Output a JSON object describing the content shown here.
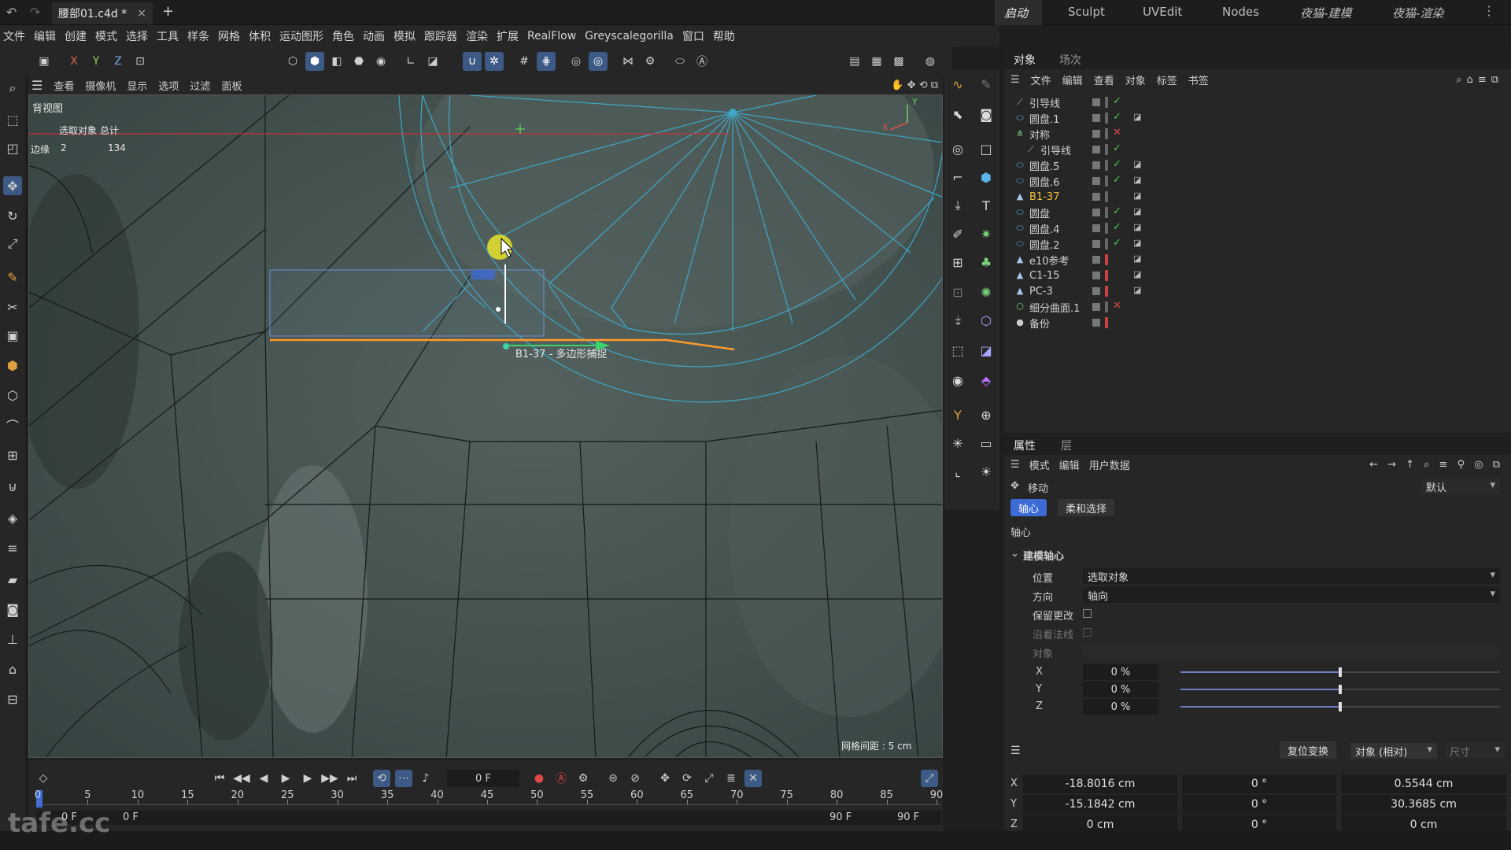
{
  "titlebar": {
    "document_tab": "腰部01.c4d *",
    "new_tab": "+",
    "close": "×",
    "layouts": [
      "启动",
      "Sculpt",
      "UVEdit",
      "Nodes",
      "夜猫-建模",
      "夜猫-渲染"
    ],
    "active_layout": "启动"
  },
  "menubar": [
    "文件",
    "编辑",
    "创建",
    "模式",
    "选择",
    "工具",
    "样条",
    "网格",
    "体积",
    "运动图形",
    "角色",
    "动画",
    "模拟",
    "跟踪器",
    "渲染",
    "扩展",
    "RealFlow",
    "Greyscalegorilla",
    "窗口",
    "帮助"
  ],
  "toolbar": {
    "axes": [
      "X",
      "Y",
      "Z"
    ]
  },
  "viewport": {
    "menu": [
      "查看",
      "摄像机",
      "显示",
      "选项",
      "过滤",
      "面板"
    ],
    "view_name": "背视图",
    "stats_header": "选取对象 总计",
    "stats_row_label": "边缘",
    "stats_selected": "2",
    "stats_total": "134",
    "snap_tooltip": "B1-37 - 多边形捕捉",
    "grid_spacing": "网格间距 : 5 cm",
    "axis_x": "X",
    "axis_y": "Y"
  },
  "object_manager": {
    "tabs": [
      "对象",
      "场次"
    ],
    "menu": [
      "文件",
      "编辑",
      "查看",
      "对象",
      "标签",
      "书签"
    ],
    "objects": [
      {
        "name": "引导线",
        "icon": "spline-icon",
        "indent": 0,
        "check": "green"
      },
      {
        "name": "圆盘.1",
        "icon": "disc-icon",
        "indent": 0,
        "check": "green"
      },
      {
        "name": "对称",
        "icon": "symmetry-icon",
        "indent": 0,
        "check": "red"
      },
      {
        "name": "引导线",
        "icon": "spline-icon",
        "indent": 1,
        "check": "green"
      },
      {
        "name": "圆盘.5",
        "icon": "disc-icon",
        "indent": 0,
        "check": "green"
      },
      {
        "name": "圆盘.6",
        "icon": "disc-icon",
        "indent": 0,
        "check": "green"
      },
      {
        "name": "B1-37",
        "icon": "polygon-icon",
        "indent": 0,
        "check": "none",
        "highlight": true
      },
      {
        "name": "圆盘",
        "icon": "disc-icon",
        "indent": 0,
        "check": "green"
      },
      {
        "name": "圆盘.4",
        "icon": "disc-icon",
        "indent": 0,
        "check": "green"
      },
      {
        "name": "圆盘.2",
        "icon": "disc-icon",
        "indent": 0,
        "check": "green"
      },
      {
        "name": "e10参考",
        "icon": "polygon-icon",
        "indent": 0,
        "check": "dot-red"
      },
      {
        "name": "C1-15",
        "icon": "polygon-icon",
        "indent": 0,
        "check": "dot-red"
      },
      {
        "name": "PC-3",
        "icon": "polygon-icon",
        "indent": 0,
        "check": "dot-red"
      },
      {
        "name": "细分曲面.1",
        "icon": "subdivision-icon",
        "indent": 0,
        "check": "red"
      },
      {
        "name": "备份",
        "icon": "null-icon",
        "indent": 0,
        "check": "dot-red"
      }
    ]
  },
  "attributes": {
    "tabs": [
      "属性",
      "层"
    ],
    "menu": [
      "模式",
      "编辑",
      "用户数据"
    ],
    "tool_name": "移动",
    "preset": "默认",
    "subtabs": [
      "轴心",
      "柔和选择"
    ],
    "section": "轴心",
    "group": "建模轴心",
    "position_label": "位置",
    "position_value": "选取对象",
    "direction_label": "方向",
    "direction_value": "轴向",
    "keep_changes": "保留更改",
    "along_normal": "沿着法线",
    "object_label": "对象",
    "axes": [
      {
        "label": "X",
        "value": "0 %",
        "fraction": 0.5
      },
      {
        "label": "Y",
        "value": "0 %",
        "fraction": 0.5
      },
      {
        "label": "Z",
        "value": "0 %",
        "fraction": 0.5
      }
    ]
  },
  "coordinates": {
    "reset_button": "复位变换",
    "mode": "对象 (相对)",
    "size_label": "尺寸",
    "rows": [
      {
        "axis": "X",
        "pos": "-18.8016 cm",
        "rot": "0 °",
        "size": "0.5544 cm"
      },
      {
        "axis": "Y",
        "pos": "-15.1842 cm",
        "rot": "0 °",
        "size": "30.3685 cm"
      },
      {
        "axis": "Z",
        "pos": "0 cm",
        "rot": "0 °",
        "size": "0 cm"
      }
    ]
  },
  "timeline": {
    "current_frame": "0 F",
    "ticks": [
      "0",
      "5",
      "10",
      "15",
      "20",
      "25",
      "30",
      "35",
      "40",
      "45",
      "50",
      "55",
      "60",
      "65",
      "70",
      "75",
      "80",
      "85",
      "90"
    ],
    "start_frame": "0 F",
    "min_frame": "0 F",
    "end_frame": "90 F",
    "max_frame": "90 F"
  },
  "watermark": "tafe.cc"
}
